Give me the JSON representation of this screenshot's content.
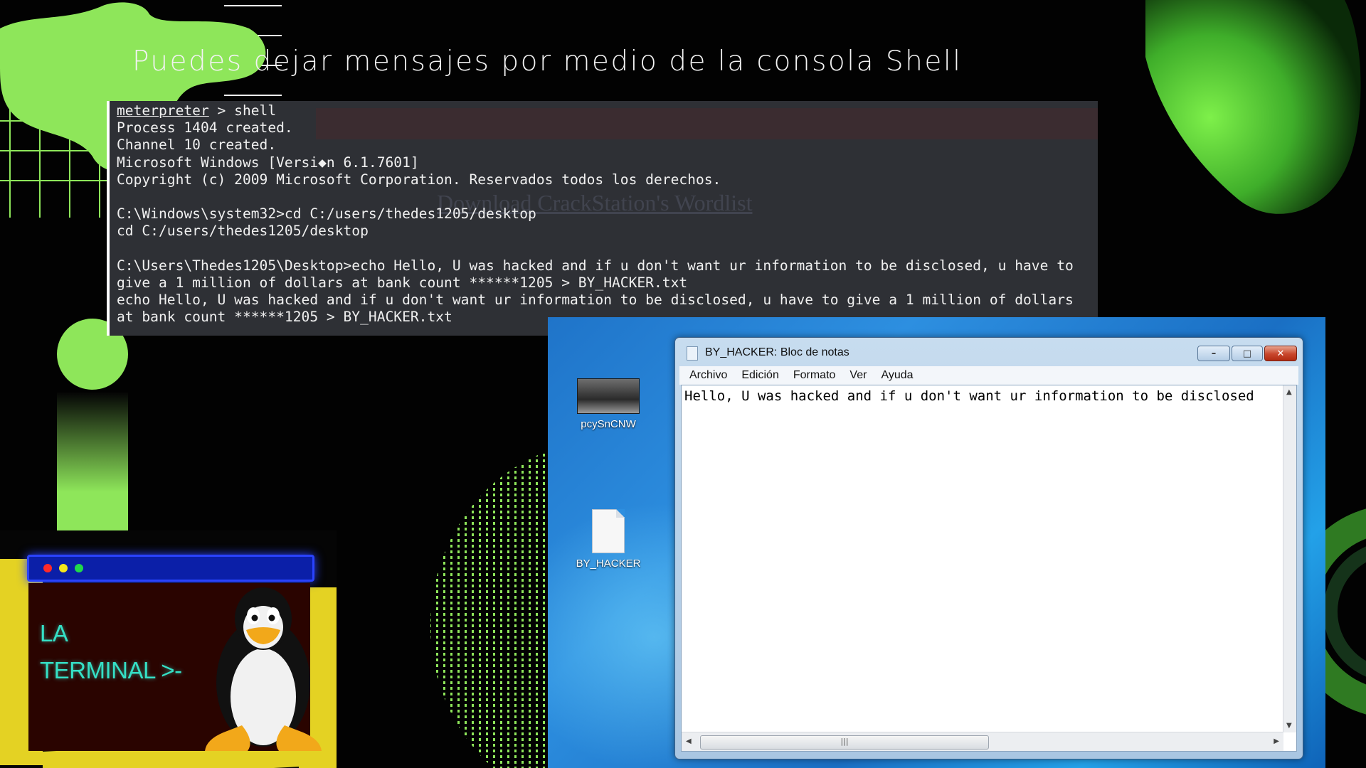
{
  "slide": {
    "title": "Puedes dejar mensajes por medio de la consola Shell"
  },
  "terminal": {
    "lines": [
      {
        "prompt": "meterpreter",
        "rest": " > shell"
      },
      {
        "text": "Process 1404 created."
      },
      {
        "text": "Channel 10 created."
      },
      {
        "text": "Microsoft Windows [Versi◆n 6.1.7601]"
      },
      {
        "text": "Copyright (c) 2009 Microsoft Corporation. Reservados todos los derechos."
      },
      {
        "text": ""
      },
      {
        "text": "C:\\Windows\\system32>cd C:/users/thedes1205/desktop"
      },
      {
        "text": "cd C:/users/thedes1205/desktop"
      },
      {
        "text": ""
      },
      {
        "text": "C:\\Users\\Thedes1205\\Desktop>echo Hello, U was hacked and if u don't want ur information to be disclosed, u have to"
      },
      {
        "text": "give a 1 million of dollars at bank count ******1205 > BY_HACKER.txt"
      },
      {
        "text": "echo Hello, U was hacked and if u don't want ur information to be disclosed, u have to give a 1 million of dollars"
      },
      {
        "text": "at bank count ******1205 > BY_HACKER.txt"
      }
    ],
    "ghost_heading": "Download CrackStation's Wordlist"
  },
  "desktop": {
    "icons": [
      {
        "label": "pcySnCNW",
        "icon": "image-file-icon"
      },
      {
        "label": "BY_HACKER",
        "icon": "text-file-icon"
      }
    ],
    "notepad": {
      "title": "BY_HACKER: Bloc de notas",
      "menu": [
        "Archivo",
        "Edición",
        "Formato",
        "Ver",
        "Ayuda"
      ],
      "content": "Hello, U was hacked and if u don't want ur information to be disclosed"
    }
  },
  "logo": {
    "line1": "LA",
    "line2": "TERMINAL >-",
    "dot_colors": [
      "#ff2a2a",
      "#f6e71b",
      "#21d94a"
    ]
  },
  "colors": {
    "accent_green": "#8ee65a",
    "terminal_bg": "#2e3035",
    "logo_text": "#35e0c6"
  }
}
